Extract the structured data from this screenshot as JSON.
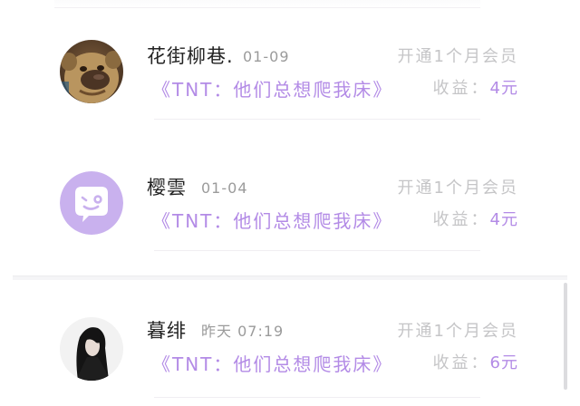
{
  "entries": [
    {
      "username": "花街柳巷.",
      "date": "01-09",
      "book_title": "《TNT：他们总想爬我床》",
      "membership": "开通1个月会员",
      "earnings_label": "收益：",
      "earnings_amount": "4元",
      "avatar": "bear-avatar-icon"
    },
    {
      "username": "樱雲",
      "date": "01-04",
      "book_title": "《TNT：他们总想爬我床》",
      "membership": "开通1个月会员",
      "earnings_label": "收益：",
      "earnings_amount": "4元",
      "avatar": "default-chat-avatar-icon"
    },
    {
      "username": "暮绯",
      "date": "昨天 07:19",
      "book_title": "《TNT：他们总想爬我床》",
      "membership": "开通1个月会员",
      "earnings_label": "收益：",
      "earnings_amount": "6元",
      "avatar": "girl-avatar-icon"
    }
  ],
  "colors": {
    "accent": "#b38be6",
    "muted": "#c5c5c7",
    "username": "#232323",
    "date": "#9b9b9b"
  }
}
